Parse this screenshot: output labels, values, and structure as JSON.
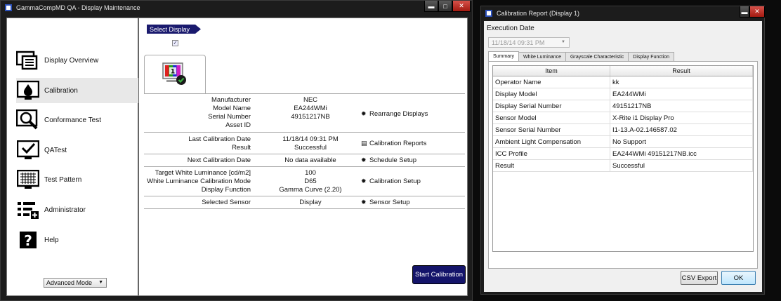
{
  "main_window": {
    "title": "GammaCompMD QA - Display Maintenance",
    "controls": {
      "minimize": "▬",
      "maximize": "□",
      "close": "✕"
    }
  },
  "sidebar": {
    "items": [
      {
        "label": "Display Overview",
        "icon": "display-overview-icon"
      },
      {
        "label": "Calibration",
        "icon": "calibration-icon",
        "selected": true
      },
      {
        "label": "Conformance Test",
        "icon": "conformance-test-icon"
      },
      {
        "label": "QATest",
        "icon": "qatest-icon"
      },
      {
        "label": "Test Pattern",
        "icon": "test-pattern-icon"
      },
      {
        "label": "Administrator",
        "icon": "administrator-icon"
      },
      {
        "label": "Help",
        "icon": "help-icon"
      }
    ],
    "mode_select": "Advanced Mode"
  },
  "content": {
    "select_display": "Select Display",
    "display_checked": "✓",
    "display_number": "1",
    "info": {
      "manufacturer_label": "Manufacturer",
      "manufacturer": "NEC",
      "model_label": "Model Name",
      "model": "EA244WMi",
      "serial_label": "Serial Number",
      "serial": "49151217NB",
      "asset_label": "Asset ID",
      "asset": ""
    },
    "calibration": {
      "last_date_label": "Last Calibration Date",
      "last_date": "11/18/14 09:31 PM",
      "result_label": "Result",
      "result": "Successful",
      "next_date_label": "Next Calibration Date",
      "next_date": "No data available"
    },
    "targets": {
      "white_lum_label": "Target White Luminance [cd/m2]",
      "white_lum": "100",
      "white_mode_label": "White Luminance Calibration Mode",
      "white_mode": "D65",
      "display_function_label": "Display Function",
      "display_function": "Gamma Curve (2.20)",
      "sensor_label": "Selected Sensor",
      "sensor": "Display"
    },
    "actions": {
      "rearrange": "Rearrange Displays",
      "reports": "Calibration Reports",
      "schedule": "Schedule Setup",
      "calibration_setup": "Calibration Setup",
      "sensor_setup": "Sensor Setup"
    },
    "start_button": "Start Calibration"
  },
  "report_window": {
    "title": "Calibration Report (Display 1)",
    "controls": {
      "minimize": "▬",
      "close": "✕"
    },
    "execution_date_label": "Execution Date",
    "execution_date": "11/18/14 09:31 PM",
    "tabs": [
      "Summary",
      "White Luminance",
      "Grayscale Characteristic",
      "Display Function"
    ],
    "table": {
      "headers": [
        "Item",
        "Result"
      ],
      "rows": [
        [
          "Operator Name",
          "kk"
        ],
        [
          "Display Model",
          "EA244WMi"
        ],
        [
          "Display Serial Number",
          "49151217NB"
        ],
        [
          "Sensor Model",
          "X-Rite i1 Display Pro"
        ],
        [
          "Sensor Serial Number",
          "I1-13.A-02.146587.02"
        ],
        [
          "Ambient Light Compensation",
          "No Support"
        ],
        [
          "ICC Profile",
          "EA244WMi 49151217NB.icc"
        ],
        [
          "Result",
          "Successful"
        ]
      ]
    },
    "csv_button": "CSV Export",
    "ok_button": "OK"
  },
  "colors": {
    "accent_navy": "#14146a",
    "window_chrome": "#1c1c1c",
    "ok_green": "#3cb043"
  }
}
